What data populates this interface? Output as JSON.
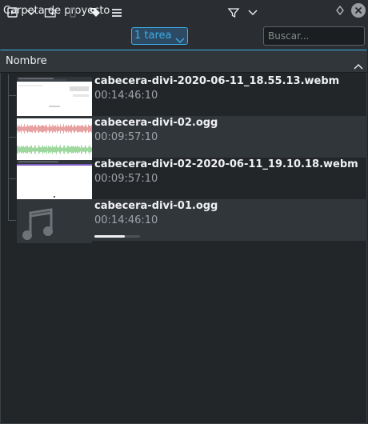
{
  "window": {
    "title": "Carpeta de proyecto"
  },
  "toolbar": {
    "task_label": "1 tarea",
    "search_placeholder": "Buscar..."
  },
  "list": {
    "column_header": "Nombre",
    "items": [
      {
        "name": "cabecera-divi-2020-06-11_18.55.13.webm",
        "duration": "00:14:46:10",
        "thumb": "video-screen"
      },
      {
        "name": "cabecera-divi-02.ogg",
        "duration": "00:09:57:10",
        "thumb": "audio-waveform"
      },
      {
        "name": "cabecera-divi-02-2020-06-11_19.10.18.webm",
        "duration": "00:09:57:10",
        "thumb": "video-blank"
      },
      {
        "name": "cabecera-divi-01.ogg",
        "duration": "00:14:46:10",
        "thumb": "music-note-icon",
        "progress": 0.66
      }
    ]
  },
  "colors": {
    "accent": "#3daee9",
    "background": "#232629",
    "alt_row": "#31363b"
  }
}
